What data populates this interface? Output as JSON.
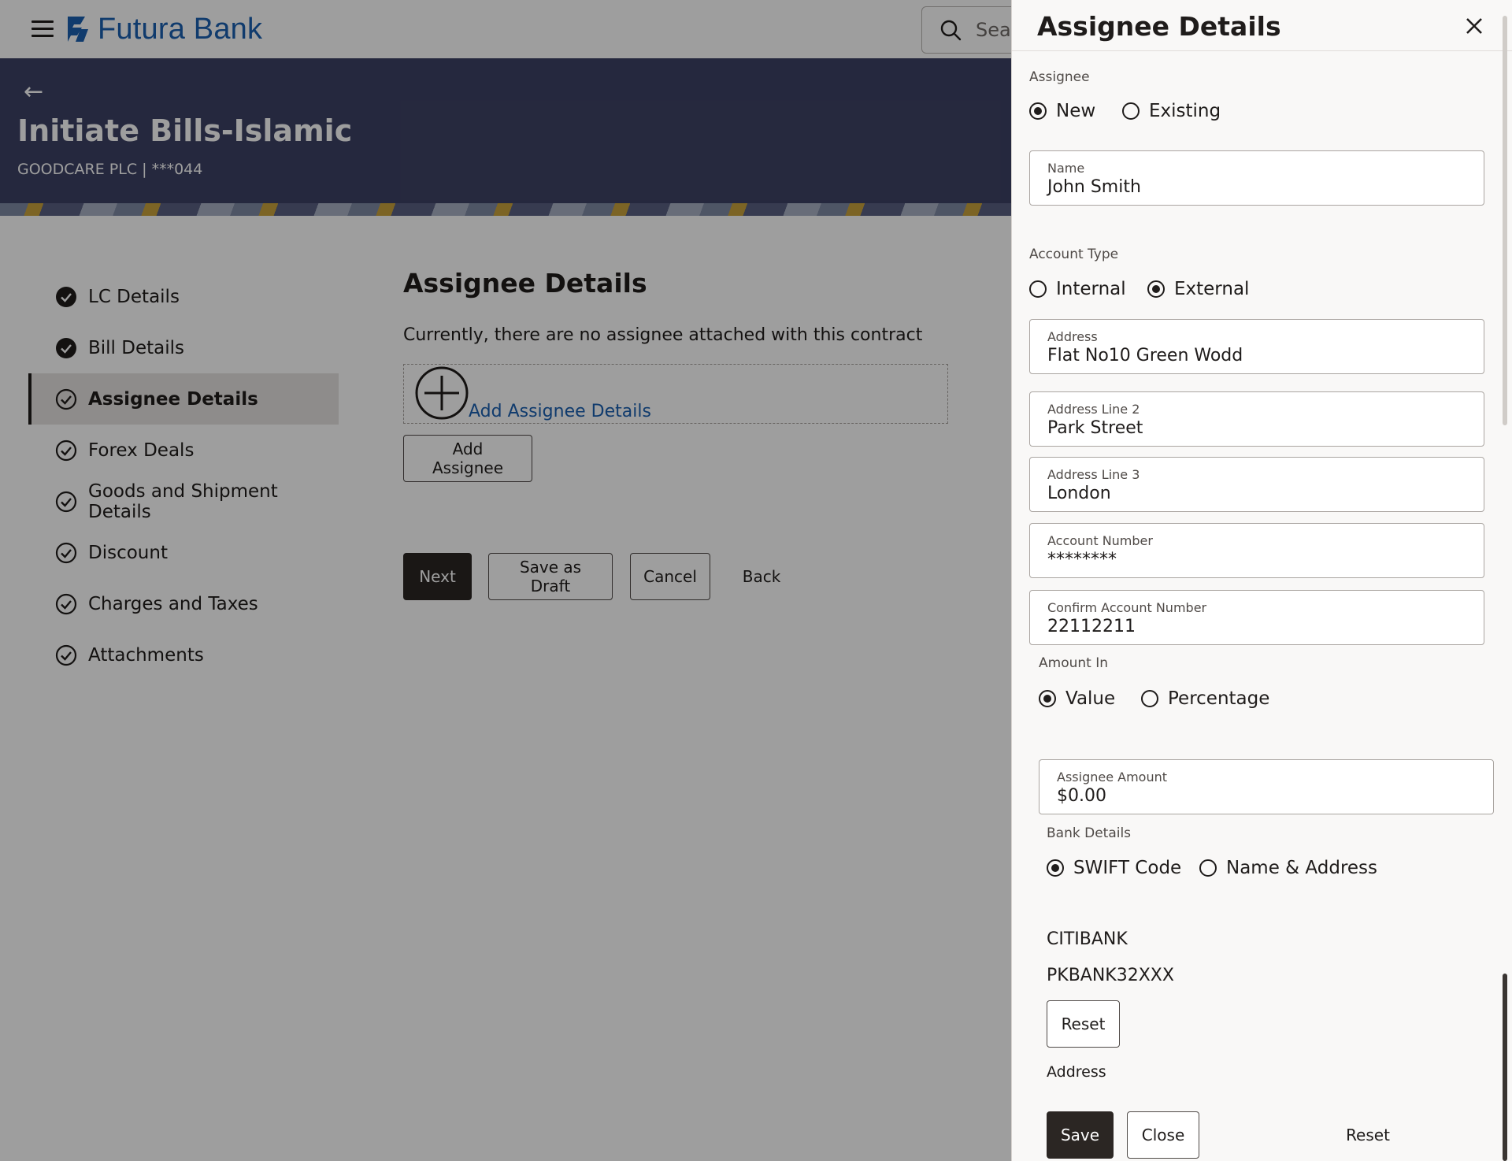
{
  "header": {
    "brand": "Futura Bank",
    "search_placeholder": "Sear"
  },
  "banner": {
    "title": "Initiate Bills-Islamic",
    "subtitle": "GOODCARE PLC | ***044"
  },
  "steps": [
    {
      "label": "LC Details",
      "state": "done"
    },
    {
      "label": "Bill Details",
      "state": "done"
    },
    {
      "label": "Assignee Details",
      "state": "active"
    },
    {
      "label": "Forex Deals",
      "state": "pending"
    },
    {
      "label": "Goods and Shipment Details",
      "state": "pending"
    },
    {
      "label": "Discount",
      "state": "pending"
    },
    {
      "label": "Charges and Taxes",
      "state": "pending"
    },
    {
      "label": "Attachments",
      "state": "pending"
    }
  ],
  "main": {
    "section_title": "Assignee Details",
    "info_text": "Currently, there are no assignee attached with this contract",
    "add_link": "Add Assignee Details",
    "add_assignee_button": "Add Assignee",
    "next_button": "Next",
    "save_draft_button": "Save as Draft",
    "cancel_button": "Cancel",
    "back_button": "Back"
  },
  "drawer": {
    "title": "Assignee Details",
    "assignee": {
      "label": "Assignee",
      "options": [
        "New",
        "Existing"
      ],
      "selected": "New"
    },
    "name": {
      "label": "Name",
      "value": "John Smith"
    },
    "account_type": {
      "label": "Account Type",
      "options": [
        "Internal",
        "External"
      ],
      "selected": "External"
    },
    "address": {
      "label": "Address",
      "value": "Flat No10 Green Wodd"
    },
    "address2": {
      "label": "Address Line 2",
      "value": "Park Street"
    },
    "address3": {
      "label": "Address Line 3",
      "value": "London"
    },
    "account_number": {
      "label": "Account Number",
      "value": "********"
    },
    "confirm_account_number": {
      "label": "Confirm Account Number",
      "value": "22112211"
    },
    "amount_in": {
      "label": "Amount In",
      "options": [
        "Value",
        "Percentage"
      ],
      "selected": "Value"
    },
    "assignee_amount": {
      "label": "Assignee Amount",
      "value": "$0.00"
    },
    "bank_details": {
      "label": "Bank Details",
      "options": [
        "SWIFT Code",
        "Name & Address"
      ],
      "selected": "SWIFT Code"
    },
    "bank_name": "CITIBANK",
    "swift_code": "PKBANK32XXX",
    "reset_button": "Reset",
    "address_label": "Address",
    "save_button": "Save",
    "close_button": "Close",
    "footer_reset_button": "Reset"
  }
}
